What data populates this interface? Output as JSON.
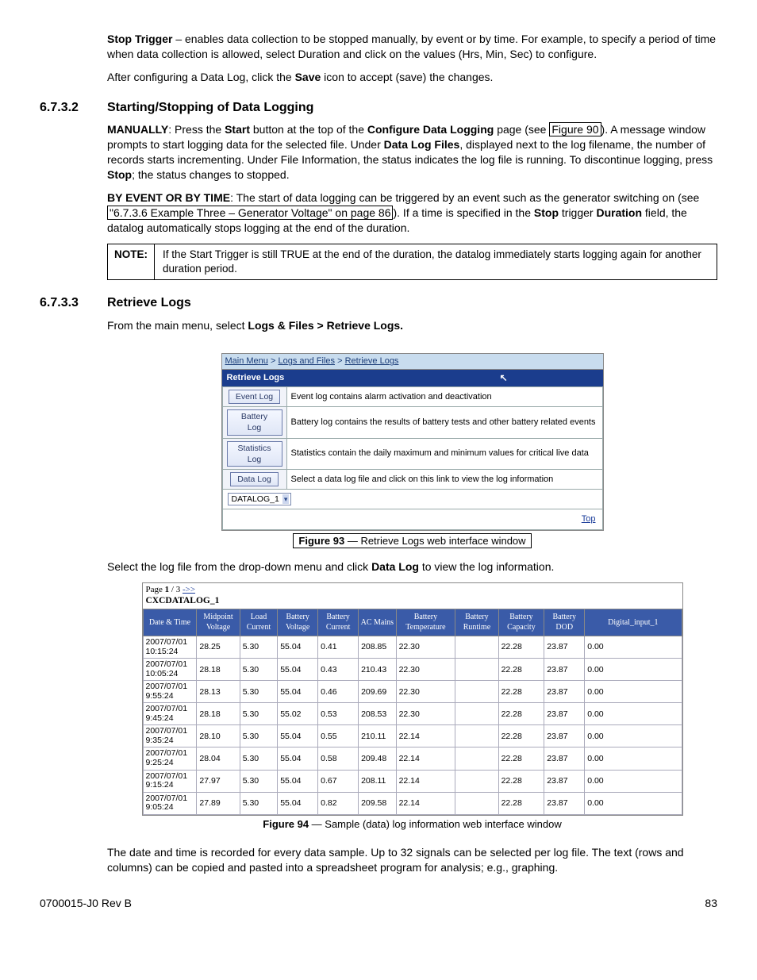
{
  "p1_lead": "Stop Trigger",
  "p1_rest": " – enables data collection to be stopped manually, by event or by time. For example, to specify a period of time when data collection is allowed, select Duration and click on the values (Hrs, Min, Sec) to configure.",
  "p2_a": "After configuring a Data Log, click the ",
  "p2_b": "Save",
  "p2_c": " icon to accept (save) the changes.",
  "sec_6732_num": "6.7.3.2",
  "sec_6732_title": "Starting/Stopping of Data Logging",
  "p3_a": "MANUALLY",
  "p3_b": ": Press the ",
  "p3_c": "Start",
  "p3_d": " button at the top of the ",
  "p3_e": "Configure Data Logging",
  "p3_f": " page (see ",
  "p3_g": "Figure 90",
  "p3_h": "). A message window prompts to start logging data for the selected file. Under ",
  "p3_i": "Data Log Files",
  "p3_j": ", displayed next to the log filename, the number of records starts incrementing. Under File Information, the status indicates the log file is running. To discontinue logging, press ",
  "p3_k": "Stop",
  "p3_l": "; the status changes to stopped.",
  "p4_a": "BY EVENT OR BY TIME",
  "p4_b": ": The start of data logging can be triggered by an event such as the generator switching on (see ",
  "p4_c": "\"6.7.3.6 Example Three – Generator Voltage\" on page 86",
  "p4_d": "). If a time is specified in the ",
  "p4_e": "Stop",
  "p4_f": " trigger ",
  "p4_g": "Duration",
  "p4_h": " field, the datalog automatically stops logging at the end of the duration.",
  "note_label": "NOTE:",
  "note_body": "If the Start Trigger is still TRUE at the end of the duration, the datalog immediately starts logging again for another duration period.",
  "sec_6733_num": "6.7.3.3",
  "sec_6733_title": "Retrieve Logs",
  "p5_a": "From the main menu, select ",
  "p5_b": "Logs & Files > Retrieve Logs.",
  "fig93": {
    "breadcrumb_a": "Main Menu",
    "breadcrumb_b": "Logs and Files",
    "breadcrumb_c": "Retrieve Logs",
    "title": "Retrieve Logs",
    "rows": [
      {
        "btn": "Event Log",
        "desc": "Event log contains alarm activation and deactivation"
      },
      {
        "btn": "Battery Log",
        "desc": "Battery log contains the results of battery tests and other battery related events"
      },
      {
        "btn": "Statistics Log",
        "desc": "Statistics contain the daily maximum and minimum values for critical live data"
      },
      {
        "btn": "Data Log",
        "desc": "Select a data log file and click on this link to view the log information"
      }
    ],
    "dropdown": "DATALOG_1",
    "top": "Top"
  },
  "fig93_caption_a": "Figure 93",
  "fig93_caption_b": "  —  Retrieve Logs web interface window",
  "p6_a": "Select the log file from the drop-down menu and click ",
  "p6_b": "Data Log",
  "p6_c": " to view the log information.",
  "fig94": {
    "pager_a": "Page ",
    "pager_b": "1",
    "pager_c": " / 3 ",
    "pager_d": "->>",
    "dsname": "CXCDATALOG_1",
    "headers": [
      "Date & Time",
      "Midpoint Voltage",
      "Load Current",
      "Battery Voltage",
      "Battery Current",
      "AC Mains",
      "Battery Temperature",
      "Battery Runtime",
      "Battery Capacity",
      "Battery DOD",
      "Digital_input_1"
    ],
    "rows": [
      [
        "2007/07/01 10:15:24",
        "28.25",
        "5.30",
        "55.04",
        "0.41",
        "208.85",
        "22.30",
        "",
        "22.28",
        "23.87",
        "0.00"
      ],
      [
        "2007/07/01 10:05:24",
        "28.18",
        "5.30",
        "55.04",
        "0.43",
        "210.43",
        "22.30",
        "",
        "22.28",
        "23.87",
        "0.00"
      ],
      [
        "2007/07/01 9:55:24",
        "28.13",
        "5.30",
        "55.04",
        "0.46",
        "209.69",
        "22.30",
        "",
        "22.28",
        "23.87",
        "0.00"
      ],
      [
        "2007/07/01 9:45:24",
        "28.18",
        "5.30",
        "55.02",
        "0.53",
        "208.53",
        "22.30",
        "",
        "22.28",
        "23.87",
        "0.00"
      ],
      [
        "2007/07/01 9:35:24",
        "28.10",
        "5.30",
        "55.04",
        "0.55",
        "210.11",
        "22.14",
        "",
        "22.28",
        "23.87",
        "0.00"
      ],
      [
        "2007/07/01 9:25:24",
        "28.04",
        "5.30",
        "55.04",
        "0.58",
        "209.48",
        "22.14",
        "",
        "22.28",
        "23.87",
        "0.00"
      ],
      [
        "2007/07/01 9:15:24",
        "27.97",
        "5.30",
        "55.04",
        "0.67",
        "208.11",
        "22.14",
        "",
        "22.28",
        "23.87",
        "0.00"
      ],
      [
        "2007/07/01 9:05:24",
        "27.89",
        "5.30",
        "55.04",
        "0.82",
        "209.58",
        "22.14",
        "",
        "22.28",
        "23.87",
        "0.00"
      ]
    ]
  },
  "fig94_caption_a": "Figure 94",
  "fig94_caption_b": "  —  Sample (data) log information web interface window",
  "p7": "The date and time is recorded for every data sample. Up to 32 signals can be selected per log file. The text (rows and columns) can be copied and pasted into a spreadsheet program for analysis; e.g., graphing.",
  "footer_left": "0700015-J0    Rev B",
  "footer_right": "83"
}
